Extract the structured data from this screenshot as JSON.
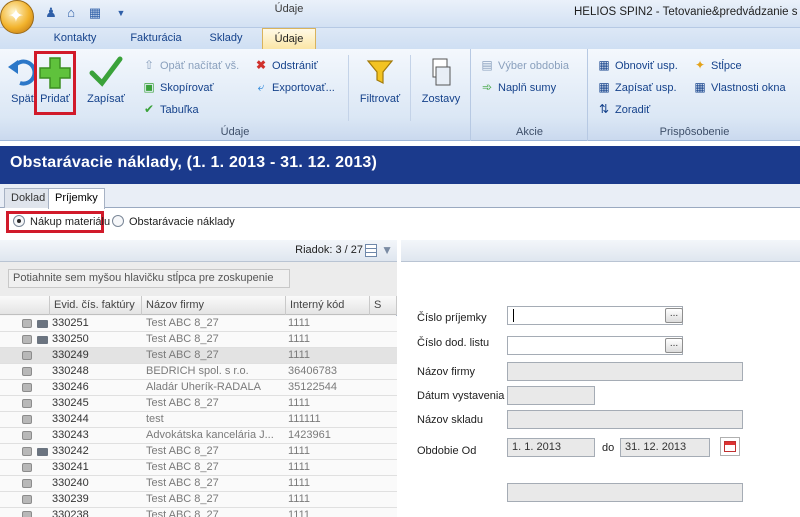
{
  "window": {
    "title": "HELIOS SPIN2 - Tetovanie&predvádzanie s",
    "context_tab": "Údaje"
  },
  "quick_access": [
    "app-icon",
    "home-icon",
    "grid-icon",
    "dropdown-icon"
  ],
  "tabs": [
    {
      "label": "Kontakty"
    },
    {
      "label": "Fakturácia"
    },
    {
      "label": "Sklady"
    },
    {
      "label": "Údaje",
      "active": true
    }
  ],
  "ribbon": {
    "udaje": {
      "label": "Údaje",
      "spat": "Späť",
      "pridat": "Pridať",
      "zapisat": "Zapísať",
      "opat_nacitat": "Opäť načítať vš.",
      "skopirovat": "Skopírovať",
      "tabulka": "Tabuľka",
      "odstranit": "Odstrániť",
      "exportovat": "Exportovať...",
      "filtrovat": "Filtrovať",
      "zostavy": "Zostavy"
    },
    "akcie": {
      "label": "Akcie",
      "vyber_obdobia": "Výber obdobia",
      "napln_sumy": "Naplň sumy"
    },
    "prisposobenie": {
      "label": "Prispôsobenie",
      "obnovit": "Obnoviť usp.",
      "zapisat_usp": "Zapísať usp.",
      "zoradit": "Zoradiť",
      "stlpce": "Stĺpce",
      "vlastnosti": "Vlastnosti okna"
    }
  },
  "page": {
    "title": "Obstarávacie náklady,  (1. 1. 2013 - 31. 12. 2013)"
  },
  "doc_tabs": [
    {
      "label": "Doklad"
    },
    {
      "label": "Príjemky",
      "active": true
    }
  ],
  "radios": {
    "nakup": "Nákup materiálu",
    "obstaravacie": "Obstarávacie náklady"
  },
  "grid": {
    "row_indicator": "Riadok: 3 / 27",
    "group_hint": "Potiahnite sem myšou hlavičku stĺpca pre zoskupenie",
    "columns": [
      "Evid. čís. faktúry",
      "Názov firmy",
      "Interný kód",
      "S"
    ],
    "rows": [
      {
        "evid": "330251",
        "firma": "Test ABC 8_27",
        "kod": "1111",
        "ico2": true
      },
      {
        "evid": "330250",
        "firma": "Test ABC 8_27",
        "kod": "1111",
        "ico2": true
      },
      {
        "evid": "330249",
        "firma": "Test ABC 8_27",
        "kod": "1111",
        "ico2": false,
        "selected": true
      },
      {
        "evid": "330248",
        "firma": "BEDRICH spol. s r.o.",
        "kod": "36406783",
        "ico2": false
      },
      {
        "evid": "330246",
        "firma": "Aladár Uherík-RADALA",
        "kod": "35122544",
        "ico2": false
      },
      {
        "evid": "330245",
        "firma": "Test ABC 8_27",
        "kod": "1111",
        "ico2": false
      },
      {
        "evid": "330244",
        "firma": "test",
        "kod": "111111",
        "ico2": false
      },
      {
        "evid": "330243",
        "firma": "Advokátska kancelária J...",
        "kod": "1423961",
        "ico2": false
      },
      {
        "evid": "330242",
        "firma": "Test ABC 8_27",
        "kod": "1111",
        "ico2": true
      },
      {
        "evid": "330241",
        "firma": "Test ABC 8_27",
        "kod": "1111",
        "ico2": false
      },
      {
        "evid": "330240",
        "firma": "Test ABC 8_27",
        "kod": "1111",
        "ico2": false
      },
      {
        "evid": "330239",
        "firma": "Test ABC 8_27",
        "kod": "1111",
        "ico2": false
      },
      {
        "evid": "330238",
        "firma": "Test ABC 8_27",
        "kod": "1111",
        "ico2": false
      }
    ]
  },
  "form": {
    "cislo_prijemky": {
      "label": "Číslo príjemky",
      "value": ""
    },
    "cislo_dod_listu": {
      "label": "Číslo dod. listu",
      "value": ""
    },
    "nazov_firmy": {
      "label": "Názov firmy",
      "value": ""
    },
    "datum_vystavenia": {
      "label": "Dátum vystavenia",
      "value": ""
    },
    "nazov_skladu": {
      "label": "Názov skladu",
      "value": ""
    },
    "obdobie_od": {
      "label": "Obdobie Od",
      "value": "1. 1. 2013"
    },
    "do": {
      "label": "do",
      "value": "31. 12. 2013"
    },
    "dots": "..."
  }
}
